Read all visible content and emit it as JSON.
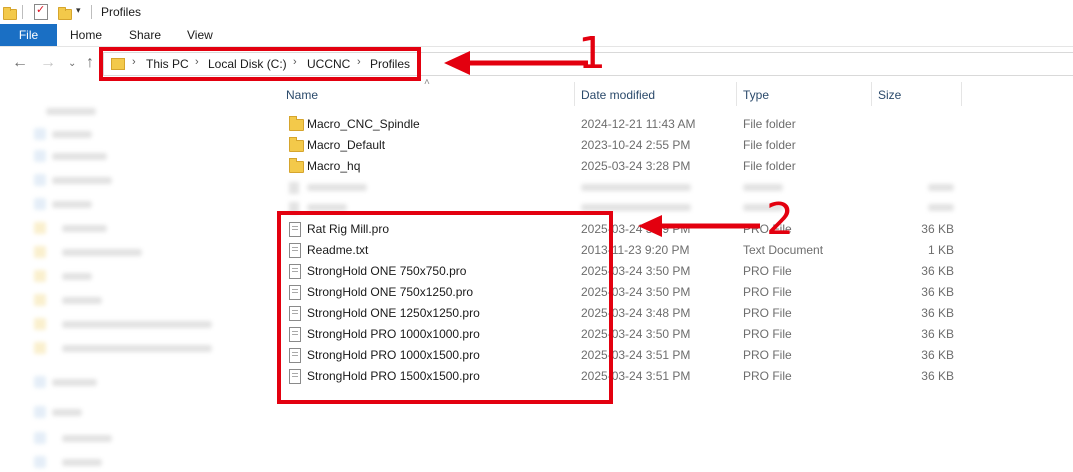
{
  "window": {
    "title": "Profiles"
  },
  "ribbon": {
    "tabs": [
      "File",
      "Home",
      "Share",
      "View"
    ]
  },
  "address": {
    "crumbs": [
      "This PC",
      "Local Disk (C:)",
      "UCCNC",
      "Profiles"
    ]
  },
  "columns": {
    "name": "Name",
    "date": "Date modified",
    "type": "Type",
    "size": "Size"
  },
  "folders": [
    {
      "name": "Macro_CNC_Spindle",
      "date": "2024-12-21 11:43 AM",
      "type": "File folder"
    },
    {
      "name": "Macro_Default",
      "date": "2023-10-24 2:55 PM",
      "type": "File folder"
    },
    {
      "name": "Macro_hq",
      "date": "2025-03-24 3:28 PM",
      "type": "File folder"
    }
  ],
  "files": [
    {
      "name": "Rat Rig Mill.pro",
      "date": "2025-03-24 3:49 PM",
      "type": "PRO File",
      "size": "36 KB"
    },
    {
      "name": "Readme.txt",
      "date": "2013-11-23 9:20 PM",
      "type": "Text Document",
      "size": "1 KB"
    },
    {
      "name": "StrongHold ONE 750x750.pro",
      "date": "2025-03-24 3:50 PM",
      "type": "PRO File",
      "size": "36 KB"
    },
    {
      "name": "StrongHold ONE 750x1250.pro",
      "date": "2025-03-24 3:50 PM",
      "type": "PRO File",
      "size": "36 KB"
    },
    {
      "name": "StrongHold ONE 1250x1250.pro",
      "date": "2025-03-24 3:48 PM",
      "type": "PRO File",
      "size": "36 KB"
    },
    {
      "name": "StrongHold PRO 1000x1000.pro",
      "date": "2025-03-24 3:50 PM",
      "type": "PRO File",
      "size": "36 KB"
    },
    {
      "name": "StrongHold PRO 1000x1500.pro",
      "date": "2025-03-24 3:51 PM",
      "type": "PRO File",
      "size": "36 KB"
    },
    {
      "name": "StrongHold PRO 1500x1500.pro",
      "date": "2025-03-24 3:51 PM",
      "type": "PRO File",
      "size": "36 KB"
    }
  ],
  "annotations": {
    "label_1": "1",
    "label_2": "2"
  },
  "colors": {
    "accent": "#1a6fc4",
    "annotation": "#e3000f",
    "folder": "#f3c94a"
  }
}
